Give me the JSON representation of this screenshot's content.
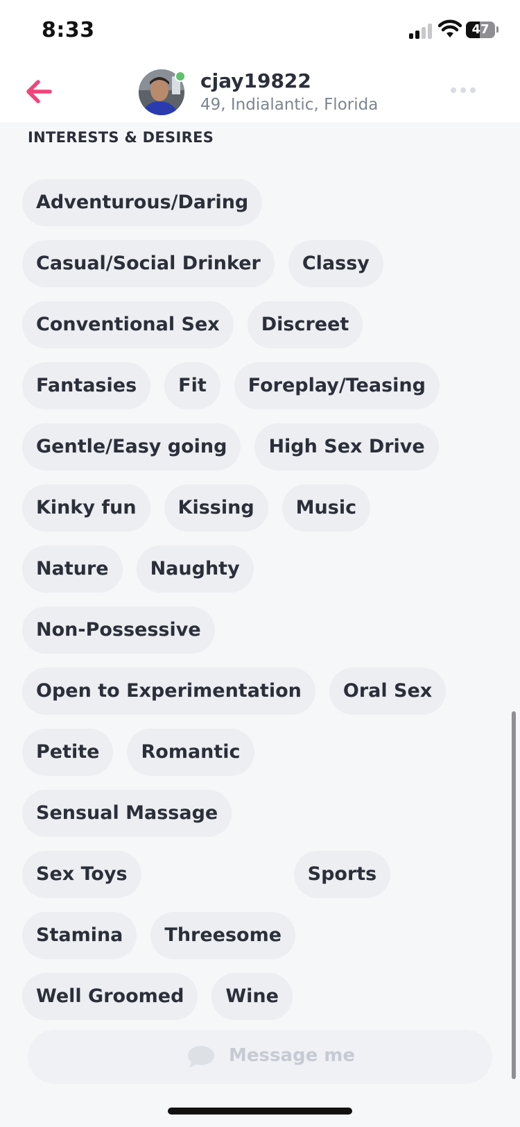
{
  "status_bar": {
    "time": "8:33",
    "battery": "47",
    "battery_level": 0.47,
    "signal_bars": 2,
    "signal_max": 4,
    "icons": [
      "cellular-signal-icon",
      "wifi-icon",
      "battery-icon"
    ]
  },
  "header": {
    "back_icon": "arrow-left-icon",
    "username": "cjay19822",
    "meta": "49, Indialantic, Florida",
    "online": true,
    "more_icon": "ellipsis-icon"
  },
  "section": {
    "title": "INTERESTS & DESIRES"
  },
  "interests": [
    "Adventurous/Daring",
    "Casual/Social Drinker",
    "Classy",
    "Conventional Sex",
    "Discreet",
    "Fantasies",
    "Fit",
    "Foreplay/Teasing",
    "Gentle/Easy going",
    "High Sex Drive",
    "Kinky fun",
    "Kissing",
    "Music",
    "Nature",
    "Naughty",
    "Non-Possessive",
    "Open to Experimentation",
    "Oral Sex",
    "Petite",
    "Romantic",
    "Sensual Massage",
    "Sex Toys",
    "Sports",
    "Stamina",
    "Threesome",
    "Well Groomed",
    "Wine"
  ],
  "message": {
    "label": "Message me",
    "icon": "chat-bubble-icon"
  },
  "colors": {
    "accent": "#f2437a",
    "online": "#5cc26b",
    "chip_bg": "#eceef1",
    "page_bg": "#f6f7f9"
  }
}
